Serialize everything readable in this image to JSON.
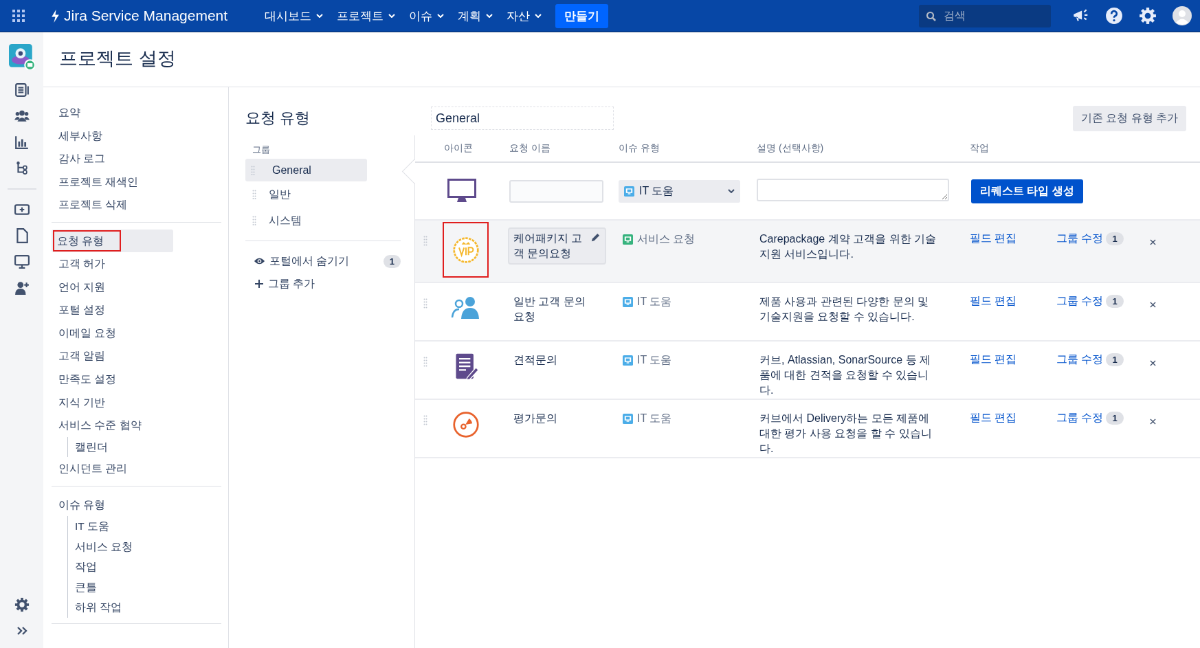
{
  "topbar": {
    "product": "Jira Service Management",
    "menus": [
      "대시보드",
      "프로젝트",
      "이슈",
      "계획",
      "자산"
    ],
    "create": "만들기",
    "search": {
      "placeholder": "검색"
    }
  },
  "page_title": "프로젝트 설정",
  "settings_nav": [
    {
      "items": [
        {
          "label": "요약",
          "selected": false,
          "outlined": false
        },
        {
          "label": "세부사항",
          "selected": false,
          "outlined": false
        },
        {
          "label": "감사 로그",
          "selected": false,
          "outlined": false
        },
        {
          "label": "프로젝트 재색인",
          "selected": false,
          "outlined": false
        },
        {
          "label": "프로젝트 삭제",
          "selected": false,
          "outlined": false
        }
      ]
    },
    {
      "items": [
        {
          "label": "요청 유형",
          "selected": true,
          "outlined": true
        },
        {
          "label": "고객 허가",
          "selected": false,
          "outlined": false
        },
        {
          "label": "언어 지원",
          "selected": false,
          "outlined": false
        },
        {
          "label": "포털 설정",
          "selected": false,
          "outlined": false
        },
        {
          "label": "이메일 요청",
          "selected": false,
          "outlined": false
        },
        {
          "label": "고객 알림",
          "selected": false,
          "outlined": false
        },
        {
          "label": "만족도 설정",
          "selected": false,
          "outlined": false
        },
        {
          "label": "지식 기반",
          "selected": false,
          "outlined": false
        },
        {
          "label": "서비스 수준 협약",
          "selected": false,
          "outlined": false,
          "children": [
            {
              "label": "캘린더",
              "selected": false
            }
          ]
        },
        {
          "label": "인시던트 관리",
          "selected": false,
          "outlined": false
        }
      ]
    },
    {
      "items": [
        {
          "label": "이슈 유형",
          "selected": false,
          "outlined": false,
          "children": [
            {
              "label": "IT 도움",
              "selected": false
            },
            {
              "label": "서비스 요청",
              "selected": false
            },
            {
              "label": "작업",
              "selected": false
            },
            {
              "label": "큰틀",
              "selected": false
            },
            {
              "label": "하위 작업",
              "selected": false
            }
          ]
        }
      ]
    }
  ],
  "section_title": "요청 유형",
  "group_name_field": "General",
  "add_existing_button": "기존 요청 유형 추가",
  "groups_label": "그룹",
  "groups": [
    {
      "label": "General",
      "selected": true
    },
    {
      "label": "일반",
      "selected": false
    },
    {
      "label": "시스템",
      "selected": false
    }
  ],
  "hidden_from_portal": {
    "label": "포털에서 숨기기",
    "count": "1"
  },
  "add_group": "그룹 추가",
  "table": {
    "columns": [
      "아이콘",
      "요청 이름",
      "이슈 유형",
      "설명 (선택사항)",
      "작업"
    ],
    "new_row": {
      "issue_type": {
        "label": "IT 도움",
        "color": "#4bade8"
      },
      "create_button": "리퀘스트 타입 생성"
    },
    "rows": [
      {
        "kind": "vip",
        "icon_outlined": true,
        "highlighted": true,
        "name": "케어패키지 고객 문의요청",
        "editing": true,
        "issue_type": {
          "label": "서비스 요청",
          "color": "#36b37e"
        },
        "description": "Carepackage 계약 고객을 위한 기술지원 서비스입니다.",
        "edit_fields": "필드 편집",
        "edit_groups": "그룹 수정",
        "group_count": "1"
      },
      {
        "kind": "people",
        "icon_outlined": false,
        "highlighted": false,
        "name": "일반 고객 문의요청",
        "editing": false,
        "issue_type": {
          "label": "IT 도움",
          "color": "#4bade8"
        },
        "description": "제품 사용과 관련된 다양한 문의 및 기술지원을 요청할 수 있습니다.",
        "edit_fields": "필드 편집",
        "edit_groups": "그룹 수정",
        "group_count": "1"
      },
      {
        "kind": "document",
        "icon_outlined": false,
        "highlighted": false,
        "name": "견적문의",
        "editing": false,
        "issue_type": {
          "label": "IT 도움",
          "color": "#4bade8"
        },
        "description": "커브, Atlassian, SonarSource 등 제품에 대한 견적을 요청할 수 있습니다.",
        "edit_fields": "필드 편집",
        "edit_groups": "그룹 수정",
        "group_count": "1"
      },
      {
        "kind": "target",
        "icon_outlined": false,
        "highlighted": false,
        "name": "평가문의",
        "editing": false,
        "issue_type": {
          "label": "IT 도움",
          "color": "#4bade8"
        },
        "description": "커브에서 Delivery하는 모든 제품에 대한 평가 사용 요청을 할 수 있습니다.",
        "edit_fields": "필드 편집",
        "edit_groups": "그룹 수정",
        "group_count": "1"
      }
    ]
  }
}
